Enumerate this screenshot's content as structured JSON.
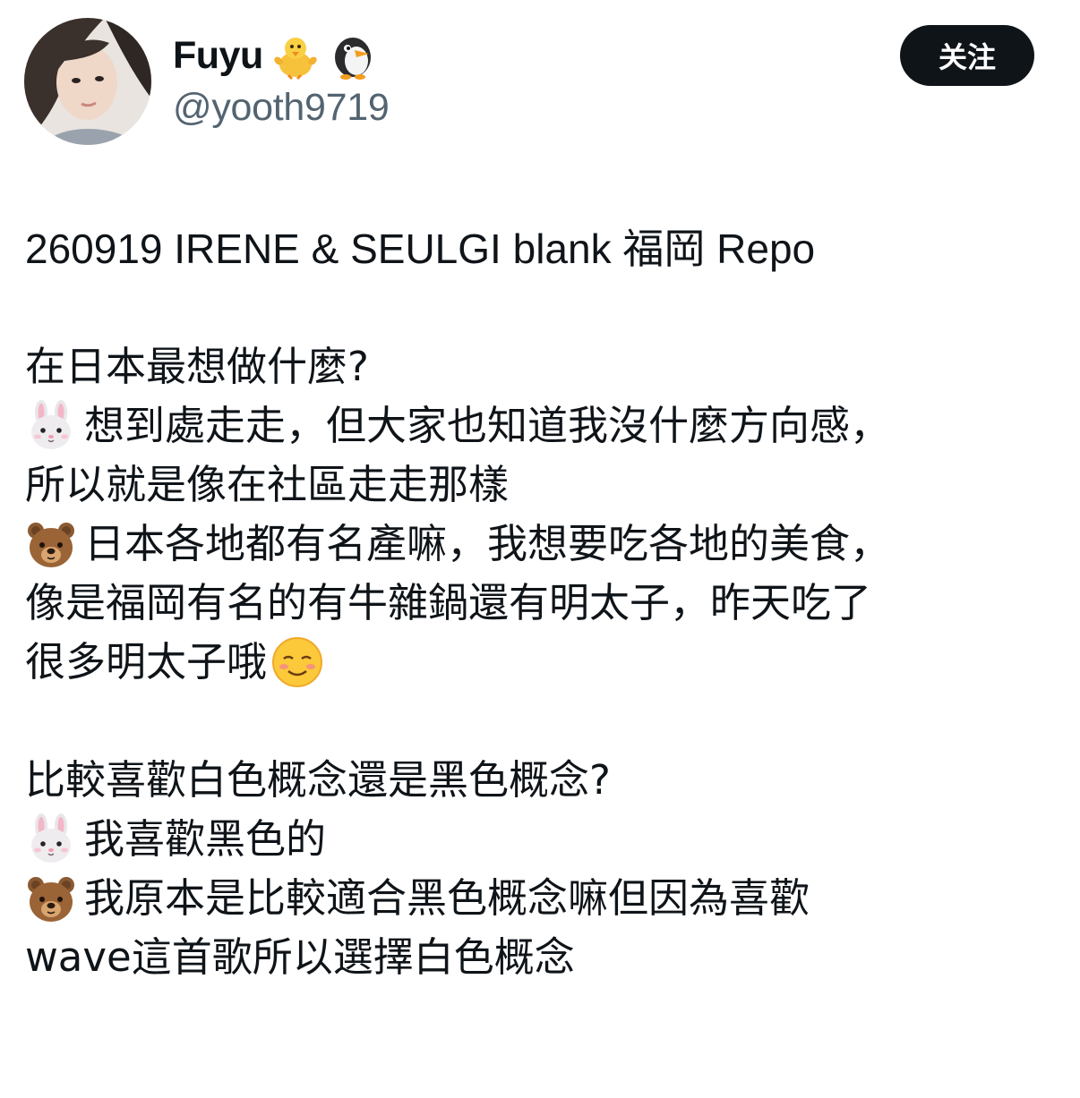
{
  "author": {
    "display_name": "Fuyu",
    "name_emojis": [
      "baby-chick-icon",
      "penguin-icon"
    ],
    "handle": "@yooth9719"
  },
  "follow_button": {
    "label": "关注"
  },
  "post": {
    "lines": [
      {
        "speaker": null,
        "text": "260919 IRENE & SEULGI blank 福岡 Repo"
      },
      {
        "speaker": null,
        "text": ""
      },
      {
        "speaker": null,
        "text": "在日本最想做什麼?"
      },
      {
        "speaker": "rabbit-face-icon",
        "text": "想到處走走，但大家也知道我沒什麼方向感，"
      },
      {
        "speaker": null,
        "text": "所以就是像在社區走走那樣"
      },
      {
        "speaker": "bear-face-icon",
        "text": "日本各地都有名產嘛，我想要吃各地的美食，"
      },
      {
        "speaker": null,
        "text": "像是福岡有名的有牛雜鍋還有明太子，昨天吃了"
      },
      {
        "speaker": null,
        "text": "很多明太子哦",
        "trailing_emoji": "smiling-face-icon"
      },
      {
        "speaker": null,
        "text": ""
      },
      {
        "speaker": null,
        "text": "比較喜歡白色概念還是黑色概念?"
      },
      {
        "speaker": "rabbit-face-icon",
        "text": "我喜歡黑色的"
      },
      {
        "speaker": "bear-face-icon",
        "text": "我原本是比較適合黑色概念嘛但因為喜歡"
      },
      {
        "speaker": null,
        "text": "wave這首歌所以選擇白色概念"
      }
    ]
  },
  "colors": {
    "text_primary": "#0f1419",
    "text_secondary": "#536471",
    "button_bg": "#0f1419",
    "button_text": "#ffffff",
    "background": "#ffffff"
  }
}
